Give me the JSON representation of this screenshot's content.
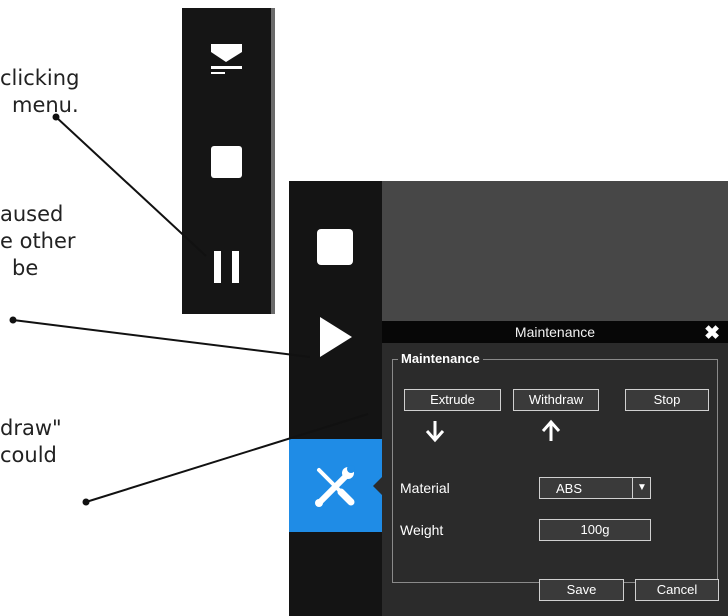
{
  "notes": [
    {
      "lines": [
        "clicking",
        "menu."
      ]
    },
    {
      "lines": [
        "aused",
        "e other",
        "be"
      ]
    },
    {
      "lines": [
        "draw\"",
        "could"
      ]
    }
  ],
  "toolbar_top": {
    "icons": [
      "unload-icon",
      "stop-icon",
      "pause-icon"
    ]
  },
  "toolbar_left": {
    "icons": [
      "stop-icon",
      "play-icon",
      "wrench-screwdriver-icon"
    ]
  },
  "dialog": {
    "title": "Maintenance",
    "close_symbol": "✖",
    "section_title": "Maintenance",
    "buttons": {
      "extrude": "Extrude",
      "withdraw": "Withdraw",
      "stop": "Stop",
      "save": "Save",
      "cancel": "Cancel"
    },
    "extrude_arrow": "🡣",
    "withdraw_arrow": "🡡",
    "material": {
      "label": "Material",
      "value": "ABS",
      "caret": "▼"
    },
    "weight": {
      "label": "Weight",
      "value": "100g"
    }
  },
  "colors": {
    "accent": "#1f8ce6",
    "toolbar": "#141414",
    "panel": "#474747",
    "dialog": "#2b2b2b"
  }
}
